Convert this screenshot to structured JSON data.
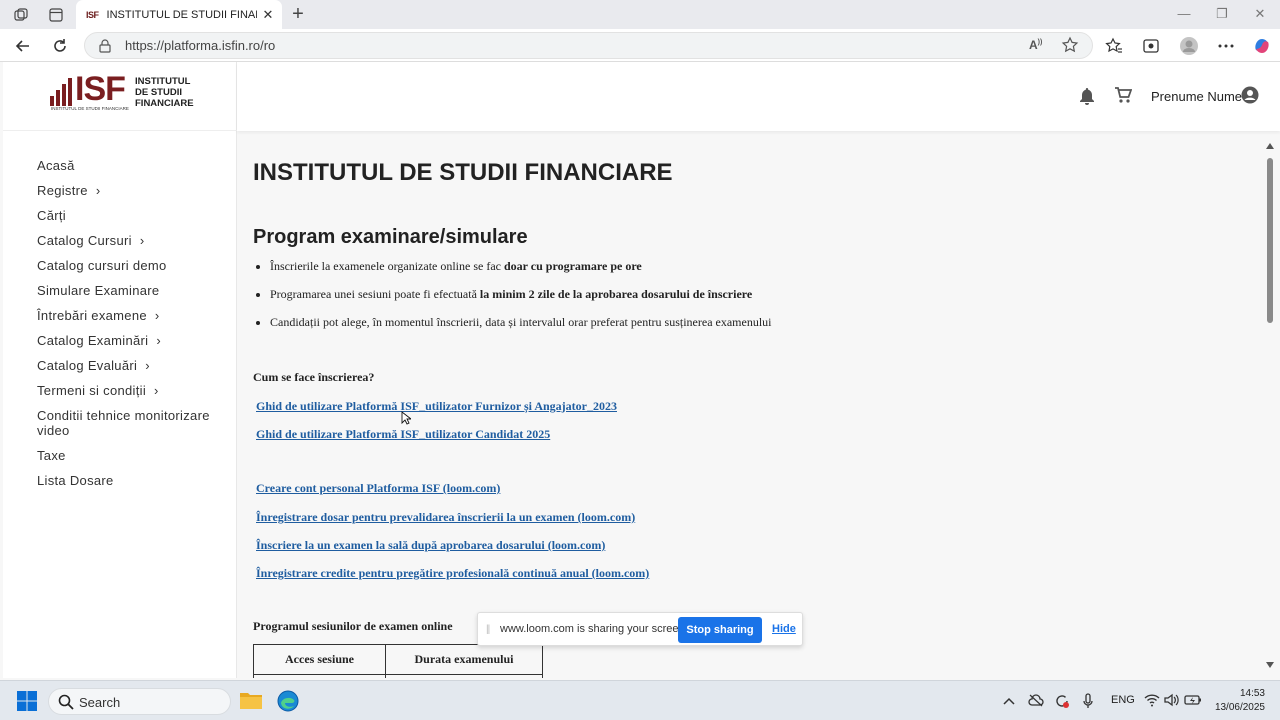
{
  "browser": {
    "tab_title": "INSTITUTUL DE STUDII FINANCIARE",
    "tab_favicon_text": "ISF",
    "url": "https://platforma.isfin.ro/ro"
  },
  "logo": {
    "mark": "ISF",
    "name_line1": "INSTITUTUL",
    "name_line2": "DE STUDII",
    "name_line3": "FINANCIARE",
    "tagline": "INSTITUTUL DE STUDII FINANCIARE"
  },
  "sidebar": {
    "items": [
      {
        "label": "Acasă"
      },
      {
        "label": "Registre"
      },
      {
        "label": "Cărți"
      },
      {
        "label": "Catalog Cursuri"
      },
      {
        "label": "Catalog cursuri demo"
      },
      {
        "label": "Simulare Examinare"
      },
      {
        "label": "Întrebări examene"
      },
      {
        "label": "Catalog Examinări"
      },
      {
        "label": "Catalog Evaluări"
      },
      {
        "label": "Termeni si condiții"
      },
      {
        "label": "Conditii tehnice monitorizare video"
      },
      {
        "label": "Taxe"
      },
      {
        "label": "Lista Dosare"
      }
    ]
  },
  "header": {
    "user_name": "Prenume Nume"
  },
  "content": {
    "title": "INSTITUTUL DE STUDII FINANCIARE",
    "section_title": "Program examinare/simulare",
    "bullet1_text": "Înscrierile la examenele organizate online se fac ",
    "bullet1_bold": "doar cu programare pe ore",
    "bullet2_text": "Programarea unei sesiuni poate fi efectuată ",
    "bullet2_bold": "la minim 2 zile de la aprobarea dosarului de înscriere",
    "bullet3_text": "Candidații pot alege, în momentul înscrierii, data și intervalul orar preferat pentru susținerea examenului",
    "how_title": "Cum se face înscrierea?",
    "links": {
      "guide1": "Ghid de utilizare Platformă ISF_utilizator Furnizor și Angajator_2023",
      "guide2": "Ghid de utilizare Platformă ISF_utilizator Candidat 2025",
      "video1": "Creare cont personal Platforma ISF (loom.com)",
      "video2": "Înregistrare dosar pentru prevalidarea înscrierii la un examen (loom.com)",
      "video3": "Înscriere la un examen la sală după aprobarea dosarului (loom.com)",
      "video4": "Înregistrare credite pentru pregătire profesională continuă anual (loom.com)"
    },
    "program_title": "Programul sesiunilor de examen online",
    "table_headers": [
      "Acces sesiune",
      "Durata examenului"
    ]
  },
  "loom_bar": {
    "message": "www.loom.com is sharing your screen.",
    "stop_label": "Stop sharing",
    "hide_label": "Hide"
  },
  "taskbar": {
    "search_label": "Search",
    "language": "ENG",
    "time": "14:53",
    "date": "13/06/2025"
  },
  "colors": {
    "brand": "#7a1e20",
    "link": "#1f5da0",
    "loom_button": "#1a73e8"
  }
}
